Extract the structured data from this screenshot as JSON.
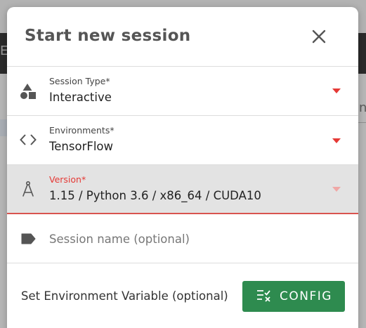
{
  "background": {
    "left_fragment": "E",
    "right_fragment": "nf"
  },
  "dialog": {
    "title": "Start new session",
    "close_icon": "close-icon",
    "session_type": {
      "label": "Session Type*",
      "value": "Interactive",
      "icon": "shapes-icon"
    },
    "environments": {
      "label": "Environments*",
      "value": "TensorFlow",
      "icon": "code-icon"
    },
    "version": {
      "label": "Version*",
      "value": "1.15 / Python 3.6 / x86_64 / CUDA10",
      "icon": "compass-icon"
    },
    "session_name": {
      "placeholder": "Session name (optional)",
      "icon": "label-tag-icon"
    },
    "env_variable": {
      "text": "Set Environment Variable (optional)",
      "button_label": "CONFIG",
      "button_icon": "checklist-icon"
    }
  },
  "colors": {
    "accent_red": "#e53935",
    "button_green": "#2e8b4f",
    "title_gray": "#555555"
  }
}
